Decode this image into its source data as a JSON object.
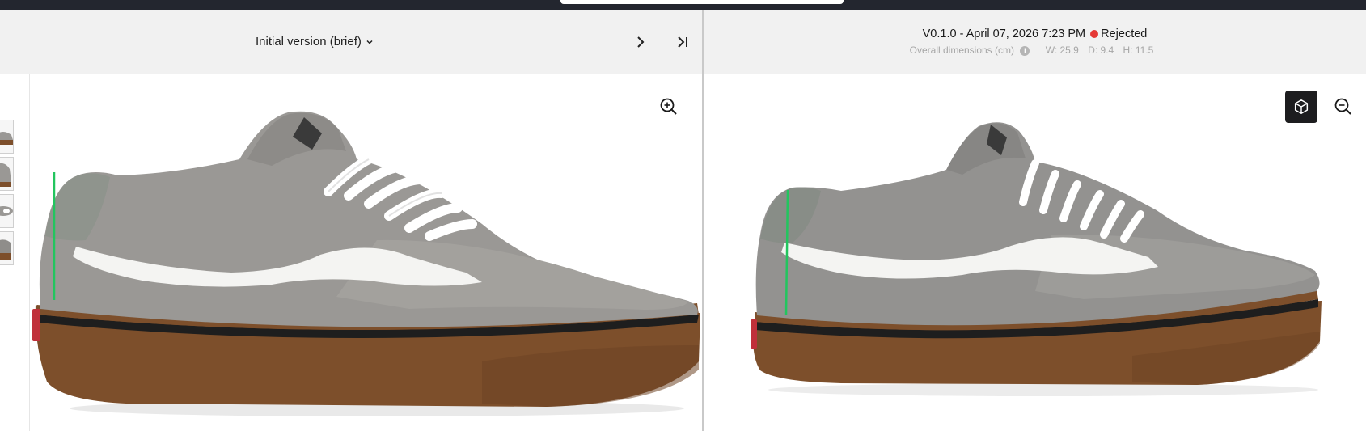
{
  "left": {
    "version_label": "Initial version (brief)",
    "icons": {
      "dropdown": "chevron-down-icon",
      "next": "chevron-right-icon",
      "last": "skip-to-last-icon",
      "zoom": "zoom-in-icon"
    },
    "thumbnails": [
      "shoe-side-view",
      "shoe-heel-view",
      "shoe-top-view",
      "shoe-angle-view"
    ]
  },
  "right": {
    "version": "V0.1.0 - April 07, 2026 7:23 PM",
    "status": "Rejected",
    "status_color": "#e53935",
    "dimensions_label": "Overall dimensions (cm)",
    "dims": {
      "w": "W: 25.9",
      "d": "D: 9.4",
      "h": "H: 11.5"
    },
    "icons": {
      "info": "info-icon",
      "view_3d": "cube-icon",
      "zoom": "zoom-out-icon"
    }
  },
  "colors": {
    "topbar": "#23262f",
    "header_bg": "#f1f1f1",
    "suede": "#9a9895",
    "gum_sole": "#7d4f2b",
    "stripe": "#f4f4f2",
    "marker": "#22c55e"
  }
}
